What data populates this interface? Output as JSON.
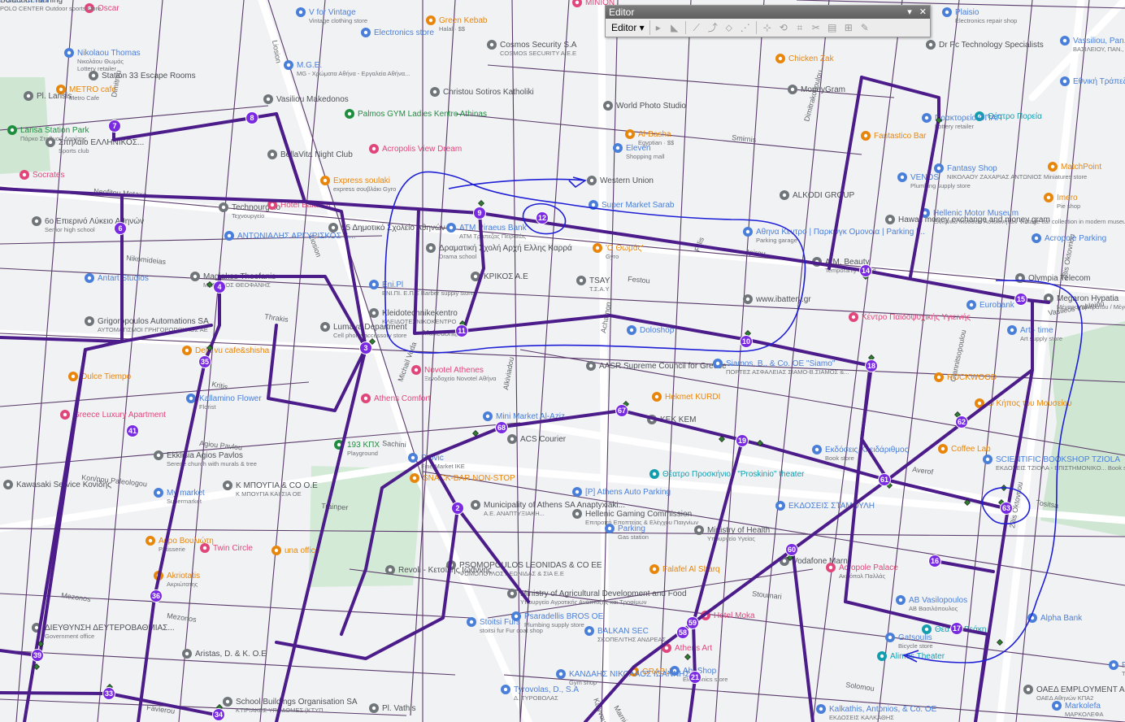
{
  "editor": {
    "title": "Editor",
    "menu_label": "Editor ▾",
    "close_glyph": "✕",
    "pin_glyph": "▾",
    "tools": [
      "pointer-tool-icon",
      "edit-vertices-icon",
      "straight-segment-icon",
      "endpoint-arc-icon",
      "trace-icon",
      "point-tool-icon",
      "split-tool-icon",
      "rotate-tool-icon",
      "reshape-icon",
      "cut-polygons-icon",
      "attributes-icon",
      "sketch-properties-icon",
      "create-features-icon"
    ]
  },
  "colors": {
    "route": "#4b1c8a",
    "node": "#7a2be2",
    "road_thin": "#5a3a6a",
    "road_white": "#ffffff",
    "park": "#cfe7d2",
    "annotation": "#1f1fd6",
    "poi_blue": "#4a7fd9",
    "poi_orange": "#e8860c",
    "poi_pink": "#e1467a",
    "poi_grey": "#70757a",
    "poi_green": "#1e8e3e",
    "poi_teal": "#129eaf"
  },
  "nodes": [
    "2",
    "3",
    "4",
    "6",
    "7",
    "8",
    "9",
    "10",
    "11",
    "12",
    "14",
    "15",
    "16",
    "17",
    "18",
    "19",
    "21",
    "33",
    "34",
    "35",
    "36",
    "39",
    "41",
    "58",
    "59",
    "60",
    "61",
    "62",
    "63",
    "67",
    "68"
  ],
  "streets": [
    "Neofitou Metaxa",
    "Nikomideias",
    "Thrakis",
    "Kritis",
    "Mezonos",
    "Agiou Pavlou",
    "Kon/nou Paleologou",
    "Trainper",
    "Sachini",
    "Makedonias",
    "Solomou",
    "Stournari",
    "Favierou",
    "Marni",
    "Acharnon",
    "Alkiviadou",
    "Feron",
    "Ipirou",
    "Smirnis",
    "Festou",
    "Vasileos Irakleiou",
    "Averof",
    "Tositsa",
    "28is Oktovriou",
    "Fillis",
    "Michail Voda",
    "Liosion",
    "Dimitrou",
    "Dimitrakopoulou",
    "Giannitsopoulou",
    "Chalkidonos",
    "Epirus"
  ],
  "pois": [
    {
      "name": "Oscar",
      "sub": "",
      "color": "poi_pink"
    },
    {
      "name": "Nikolaou Thomas",
      "sub": "Νικολάου Θωμάς\nLottery retailer",
      "color": "poi_blue"
    },
    {
      "name": "METRO cafe",
      "sub": "Metro Cafe",
      "color": "poi_orange"
    },
    {
      "name": "Station 33 Escape Rooms",
      "sub": "",
      "color": "poi_grey"
    },
    {
      "name": "Pl. Larisis",
      "sub": "",
      "color": "poi_grey"
    },
    {
      "name": "Larisa Station Park",
      "sub": "Πάρκο Σταθμού Λαρίσης",
      "color": "poi_green"
    },
    {
      "name": "Σπηλαίο ΕΛΛΗΝΙΚΟΣ...",
      "sub": "Sports club",
      "color": "poi_grey"
    },
    {
      "name": "BellaVita Night Club",
      "sub": "",
      "color": "poi_grey"
    },
    {
      "name": "Socrates",
      "sub": "",
      "color": "poi_pink"
    },
    {
      "name": "Technourgeio",
      "sub": "Τεχνουργείο",
      "color": "poi_grey"
    },
    {
      "name": "Hotel Balasca",
      "sub": "",
      "color": "poi_pink"
    },
    {
      "name": "6ο Επιερινό Λύκειο Αθηνών",
      "sub": "Senior high school",
      "color": "poi_grey"
    },
    {
      "name": "55 Δημοτικό Σχολείο Αθηνών",
      "sub": "",
      "color": "poi_grey"
    },
    {
      "name": "ΑΝΤΩΝΙΑΔΗΣ ΑΡΓΥΡΙΣΚΟΣ &...",
      "sub": "",
      "color": "poi_blue"
    },
    {
      "name": "Magiakos Theofanis",
      "sub": "ΜΑΓΙΑΚΟΣ ΘΕΟΦΑΝΗΣ",
      "color": "poi_grey"
    },
    {
      "name": "Antart Studios",
      "sub": "",
      "color": "poi_blue"
    },
    {
      "name": "Grigoropoulos Automations SA",
      "sub": "ΑΥΤΟΜΑΤΙΣΜΟΙ ΓΡΗΓΟΡΟΠΟΥΛΟΣ ΑΕ",
      "color": "poi_grey"
    },
    {
      "name": "Lumaya Department",
      "sub": "Cell phone accessory store",
      "color": "poi_grey"
    },
    {
      "name": "Deja vu cafe&shisha",
      "sub": "",
      "color": "poi_orange"
    },
    {
      "name": "Dulce Tiempo",
      "sub": "",
      "color": "poi_orange"
    },
    {
      "name": "Kallamino Flower",
      "sub": "Florist",
      "color": "poi_blue"
    },
    {
      "name": "Greece Luxury Apartment",
      "sub": "",
      "color": "poi_pink"
    },
    {
      "name": "Ekklisia Agios Pavlos",
      "sub": "Serene church with murals & tree",
      "color": "poi_grey"
    },
    {
      "name": "Kawasaki Service Κονίδης",
      "sub": "",
      "color": "poi_grey"
    },
    {
      "name": "My market",
      "sub": "Supermarket",
      "color": "poi_blue"
    },
    {
      "name": "Κ ΜΠΟΥΓΙΑ & CO O.E",
      "sub": "Κ ΜΠΟΥΓΙΑ ΚΑΙ ΣΙΑ ΟΕ",
      "color": "poi_grey"
    },
    {
      "name": "Twin Circle",
      "sub": "",
      "color": "poi_pink"
    },
    {
      "name": "Ακρο Βουλιώτη",
      "sub": "Pâtisserie",
      "color": "poi_orange"
    },
    {
      "name": "una office",
      "sub": "",
      "color": "poi_orange"
    },
    {
      "name": "Akriotatis",
      "sub": "Ακριώτατης",
      "color": "poi_orange"
    },
    {
      "name": "Aristas, D. & K. O.E",
      "sub": "",
      "color": "poi_grey"
    },
    {
      "name": "School Buildings Organisation SA",
      "sub": "ΚΤΙΡΙΑΚΕΣ ΥΠΟΔΟΜΕΣ (ΚΤΥΠ...",
      "color": "poi_grey"
    },
    {
      "name": "ΔΙΕΥΘΥΝΣΗ ΔΕΥΤΕΡΟΒΑΘΜΙΑΣ...",
      "sub": "Government office",
      "color": "poi_grey"
    },
    {
      "name": "M.G.E.",
      "sub": "MG - Χρώματα Αθήνα - Εργαλεία Αθήνα...",
      "color": "poi_blue"
    },
    {
      "name": "Vasiliou Makedonos",
      "sub": "",
      "color": "poi_grey"
    },
    {
      "name": "Palmos GYM Ladies Kentro Athinas",
      "sub": "",
      "color": "poi_green"
    },
    {
      "name": "Acropolis View Dream",
      "sub": "",
      "color": "poi_pink"
    },
    {
      "name": "Express soulaki",
      "sub": "express σουβλάκι Gyro",
      "color": "poi_orange"
    },
    {
      "name": "Electronics store",
      "sub": "",
      "color": "poi_blue"
    },
    {
      "name": "Green Kebab",
      "sub": "Halal · $$",
      "color": "poi_orange"
    },
    {
      "name": "Christou Sotiros Katholiki",
      "sub": "",
      "color": "poi_grey"
    },
    {
      "name": "Cosmos Security S.A",
      "sub": "COSMOS SECURITY A.E.E",
      "color": "poi_grey"
    },
    {
      "name": "World Photo Studio",
      "sub": "",
      "color": "poi_grey"
    },
    {
      "name": "Eleven",
      "sub": "Shopping mall",
      "color": "poi_blue"
    },
    {
      "name": "Al-Basha",
      "sub": "Egyptian · $$",
      "color": "poi_orange"
    },
    {
      "name": "Western Union",
      "sub": "",
      "color": "poi_grey"
    },
    {
      "name": "ATM Piraeus Bank",
      "sub": "ATM Τράπεζας Πειραιώς",
      "color": "poi_blue"
    },
    {
      "name": "Δραματική Σχολή Αρχή Ελλης Καρρά",
      "sub": "Drama school",
      "color": "poi_grey"
    },
    {
      "name": "ΚΡΙΚΟΣ Α.Ε",
      "sub": "",
      "color": "poi_grey"
    },
    {
      "name": "Eni.Pl",
      "sub": "ΕΝΙ.ΠΙ. Ε.Π.Ε Barber supply store",
      "color": "poi_blue"
    },
    {
      "name": "Kleidotechnikekentro",
      "sub": "ΚΛΕΙΔΟΤΕΧΝΙΚΟΚΕΝΤΡΟ",
      "color": "poi_grey"
    },
    {
      "name": "'Ο Θωμάς'",
      "sub": "Gyro",
      "color": "poi_orange"
    },
    {
      "name": "TSAY",
      "sub": "Τ.Σ.Α.Υ",
      "color": "poi_grey"
    },
    {
      "name": "Novotel Athenes",
      "sub": "Ξενοδοχείο Novotel Αθήνα",
      "color": "poi_pink"
    },
    {
      "name": "Athens Comfort",
      "sub": "",
      "color": "poi_pink"
    },
    {
      "name": "Doloshop",
      "sub": "",
      "color": "poi_blue"
    },
    {
      "name": "AASR Supreme Council for Greece",
      "sub": "",
      "color": "poi_grey"
    },
    {
      "name": "Hekmet KURDI",
      "sub": "",
      "color": "poi_orange"
    },
    {
      "name": "Siamos, B., & Co. OE \"Siamo\"",
      "sub": "ΠΟΡΤΕΣ ΑΣΦΑΛΕΙΑΣ ΣΙΑΜΟ-Β.ΣΙΑΜΟΣ &...",
      "color": "poi_blue"
    },
    {
      "name": "Mini Market Al-Aziz",
      "sub": "",
      "color": "poi_blue"
    },
    {
      "name": "ACS Courier",
      "sub": "",
      "color": "poi_grey"
    },
    {
      "name": "KEK KEM",
      "sub": "",
      "color": "poi_grey"
    },
    {
      "name": "193 ΚΠΧ",
      "sub": "Playground",
      "color": "poi_green"
    },
    {
      "name": "Provic",
      "sub": "Fine Market IKE",
      "color": "poi_blue"
    },
    {
      "name": "SNACK-BAR NON-STOP",
      "sub": "",
      "color": "poi_orange"
    },
    {
      "name": "Municipality of Athens SA Anaptyxiaki...",
      "sub": "Α.Ε. ΑΝΑΠΤΥΞΙΑΚΗ...",
      "color": "poi_grey"
    },
    {
      "name": "[P] Athens Auto Parking",
      "sub": "",
      "color": "poi_blue"
    },
    {
      "name": "Θέατρο Προσκήνιο / \"Proskinio\" theater",
      "sub": "",
      "color": "poi_teal"
    },
    {
      "name": "Hellenic Gaming Commission",
      "sub": "Επιτροπή Εποπτείας & Ελέγχου Παιγνίων",
      "color": "poi_grey"
    },
    {
      "name": "Parking",
      "sub": "Gas station",
      "color": "poi_blue"
    },
    {
      "name": "Ministry of Health",
      "sub": "Υπουργείο Υγείας",
      "color": "poi_grey"
    },
    {
      "name": "PSOMOPOULOS LEONIDAS & CO EE",
      "sub": "ΨΩΜΟΠΟΥΛΟΣ ΛΕΩΝΙΔΑΣ & ΣΙΑ Ε.Ε",
      "color": "poi_grey"
    },
    {
      "name": "Revoli - Κετσίλης Ιωάννης",
      "sub": "",
      "color": "poi_grey"
    },
    {
      "name": "Ministry of Agricultural Development and Food",
      "sub": "Υπουργείο Αγροτικής Ανάπτυξης και Τροφίμων",
      "color": "poi_grey"
    },
    {
      "name": "Stoitsi Furs",
      "sub": "stoitsi fur Fur coat shop",
      "color": "poi_blue"
    },
    {
      "name": "Psaradellis BROS OE",
      "sub": "Plumbing supply store",
      "color": "poi_blue"
    },
    {
      "name": "Falafel Al Sharq",
      "sub": "",
      "color": "poi_orange"
    },
    {
      "name": "BALKAN SEC",
      "sub": "ΣΚΟΠΕΛΙΤΗΣ ΑΝΔΡΕΑΣ",
      "color": "poi_blue"
    },
    {
      "name": "Vodafone Marni",
      "sub": "",
      "color": "poi_grey"
    },
    {
      "name": "Hotel Moka",
      "sub": "",
      "color": "poi_pink"
    },
    {
      "name": "Athens Art",
      "sub": "",
      "color": "poi_pink"
    },
    {
      "name": "GRABUS",
      "sub": "",
      "color": "poi_orange"
    },
    {
      "name": "AbaShop",
      "sub": "Electronics store",
      "color": "poi_blue"
    },
    {
      "name": "ΚΑΝΔΑΗΣ ΝΙΚΟΛΑΟΣ ΙΩΑΝΝΗΣ",
      "sub": "Gym shop",
      "color": "poi_blue"
    },
    {
      "name": "Pl. Vathis",
      "sub": "",
      "color": "poi_grey"
    },
    {
      "name": "Tyrovolas, D., S.A",
      "sub": "Δ. ΤΥΡΟΒΟΛΑΣ",
      "color": "poi_blue"
    },
    {
      "name": "MINION",
      "sub": "",
      "color": "poi_pink"
    },
    {
      "name": "Chicken Zak",
      "sub": "",
      "color": "poi_orange"
    },
    {
      "name": "MoneyGram",
      "sub": "",
      "color": "poi_grey"
    },
    {
      "name": "ALKODI GROUP",
      "sub": "",
      "color": "poi_grey"
    },
    {
      "name": "Super Market Sarab",
      "sub": "",
      "color": "poi_blue"
    },
    {
      "name": "Αθηνα Κεντρο | Παρκινγκ Ομονοια | Parking |...",
      "sub": "Parking garage",
      "color": "poi_blue"
    },
    {
      "name": "Hawali money exchange and money gram",
      "sub": "",
      "color": "poi_grey"
    },
    {
      "name": "A.M. Beauty",
      "sub": "Temporarily closed",
      "color": "poi_grey"
    },
    {
      "name": "www.ibattery.gr",
      "sub": "",
      "color": "poi_grey"
    },
    {
      "name": "Κέντρο Παιδοψυχικής Υγιεινής",
      "sub": "",
      "color": "poi_pink"
    },
    {
      "name": "Fantastico Bar",
      "sub": "",
      "color": "poi_orange"
    },
    {
      "name": "VENOS",
      "sub": "Plumbing supply store",
      "color": "poi_blue"
    },
    {
      "name": "Θέατρο Πορεία",
      "sub": "",
      "color": "poi_teal"
    },
    {
      "name": "Fantasy Shop",
      "sub": "ΝΙΚΟΛΑΟΥ ΖΑΧΑΡΙΑΣ ΑΝΤΩΝΙΟΣ Miniatures store",
      "color": "poi_blue"
    },
    {
      "name": "Hellenic Motor Museum",
      "sub": "Ελληνικό Μουσείο Αυτοκινήτων Vintage car collection in modern museum",
      "color": "poi_blue"
    },
    {
      "name": "Acropole Parking",
      "sub": "",
      "color": "poi_blue"
    },
    {
      "name": "Olympia Telecom",
      "sub": "",
      "color": "poi_grey"
    },
    {
      "name": "Eurobank",
      "sub": "",
      "color": "poi_blue"
    },
    {
      "name": "Megaron Hypatia",
      "sub": "Μέγαρο Λιβιεράτου / Μέγαρο \"Υπατία\"",
      "color": "poi_grey"
    },
    {
      "name": "Art - time",
      "sub": "Art supply store",
      "color": "poi_blue"
    },
    {
      "name": "ROCKWOOD",
      "sub": "",
      "color": "poi_orange"
    },
    {
      "name": "Ο Κήπος του Μουσείου",
      "sub": "",
      "color": "poi_orange"
    },
    {
      "name": "Εκδόσεις Κλειδάριθμος",
      "sub": "Book store",
      "color": "poi_blue"
    },
    {
      "name": "Coffee Lab",
      "sub": "",
      "color": "poi_orange"
    },
    {
      "name": "SCIENTIFIC BOOKSHOP TZIOLA",
      "sub": "ΕΚΔΟΣΕΙΣ ΤΖΙΟΛΑ - ΕΠΙΣΤΗΜΟΝΙΚΟ... Book store",
      "color": "poi_blue"
    },
    {
      "name": "ΕΚΔΟΣΕΙΣ ΣΤΑΜΟΥΛΗ",
      "sub": "",
      "color": "poi_blue"
    },
    {
      "name": "Acropole Palace",
      "sub": "Ακρόπολ Παλλάς",
      "color": "poi_pink"
    },
    {
      "name": "AB Vasilopoulos",
      "sub": "ΑΒ Βασιλόπουλος",
      "color": "poi_blue"
    },
    {
      "name": "Gatsoulis",
      "sub": "Bicycle store",
      "color": "poi_blue"
    },
    {
      "name": "Θέατρο Βεάκη",
      "sub": "",
      "color": "poi_teal"
    },
    {
      "name": "Alpha Bank",
      "sub": "",
      "color": "poi_blue"
    },
    {
      "name": "Alimos Theater",
      "sub": "",
      "color": "poi_teal"
    },
    {
      "name": "Kalkathis, Antonios, & Co. OE",
      "sub": "ΕΚΔΟΣΕΙΣ ΚΑΛΚΑΘΗΣ",
      "color": "poi_blue"
    },
    {
      "name": "ΟΑΕΔ EMPLOYMENT AGENCY FORCE OF",
      "sub": "ΟΑΕΔ Αθηνών ΚΠΑ2",
      "color": "poi_grey"
    },
    {
      "name": "Piraeus Bank",
      "sub": "Τράπεζα Πειραιώς",
      "color": "poi_blue"
    },
    {
      "name": "Markolefa",
      "sub": "ΜΑΡΚΟΛΕΦΑ",
      "color": "poi_blue"
    },
    {
      "name": "Plaisio",
      "sub": "Electronics repair shop",
      "color": "poi_blue"
    },
    {
      "name": "Dr Pc Technology Specialists",
      "sub": "",
      "color": "poi_grey"
    },
    {
      "name": "Vassiliou, Pan., & Co",
      "sub": "ΒΑΣΙΛΕΙΟΥ, ΠΑΝ., & ΣΙΑ Lighting store",
      "color": "poi_blue"
    },
    {
      "name": "Εθνική Τράπεζα",
      "sub": "",
      "color": "poi_blue"
    },
    {
      "name": "Πρακτορείο ΟΠΑΠ",
      "sub": "Lottery retailer",
      "color": "poi_blue"
    },
    {
      "name": "MatchPoint",
      "sub": "",
      "color": "poi_orange"
    },
    {
      "name": "Imero",
      "sub": "Pie shop",
      "color": "poi_orange"
    },
    {
      "name": "V for Vintage",
      "sub": "Vintage clothing store",
      "color": "poi_blue"
    },
    {
      "name": "POLO Center",
      "sub": "POLO CENTER Outdoor sports store",
      "color": "poi_blue"
    },
    {
      "name": "Solarium Tanning",
      "sub": "",
      "color": "poi_grey"
    }
  ]
}
